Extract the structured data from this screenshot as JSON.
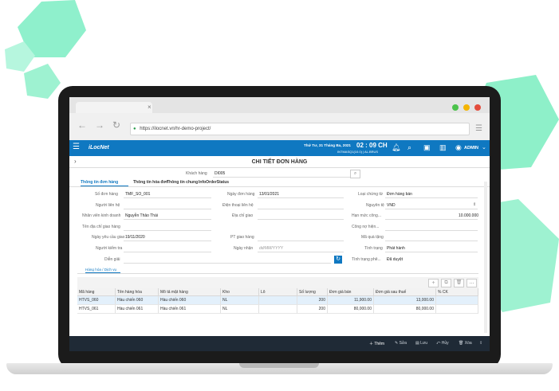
{
  "browser": {
    "url": "https://ilocnet.vn/hr-demo-project/"
  },
  "app": {
    "logo": "iLocNet",
    "datetime": "Thứ Tư, 31 Tháng Ba, 2021",
    "clock": "02 : 09 CH",
    "sub_info": "INTMASQ1(10.0) | AL.BRUS",
    "user": "ADMIN"
  },
  "page": {
    "title": "CHI TIẾT ĐƠN HÀNG",
    "customer_label": "Khách hàng",
    "customer_value": "DI005"
  },
  "tabs": [
    {
      "label": "Thông tin đơn hàng"
    },
    {
      "label": "Thông tin hóa đơn"
    },
    {
      "label": "Thông tin chung"
    },
    {
      "label": "InfoOrderStatus"
    }
  ],
  "form": {
    "col1": [
      {
        "label": "Số đơn hàng",
        "value": "TMF_SO_001"
      },
      {
        "label": "Người liên hệ",
        "value": ""
      },
      {
        "label": "Nhân viên kinh doanh",
        "value": "Nguyễn Thảo Thái"
      },
      {
        "label": "Tên địa chỉ giao hàng",
        "value": ""
      },
      {
        "label": "Ngày yêu cầu giao",
        "value": "19/11/2020"
      },
      {
        "label": "Người kiểm tra",
        "value": ""
      },
      {
        "label": "Diễn giải",
        "value": ""
      }
    ],
    "col2": [
      {
        "label": "Ngày đơn hàng",
        "value": "13/01/2021"
      },
      {
        "label": "Điện thoại liên hệ",
        "value": ""
      },
      {
        "label": "Địa chỉ giao",
        "value": ""
      },
      {
        "label": "",
        "value": ""
      },
      {
        "label": "PT giao hàng",
        "value": ""
      },
      {
        "label": "Ngày nhận",
        "value": "dd/MM/YYYY"
      }
    ],
    "col3": [
      {
        "label": "Loại chứng từ",
        "value": "Đơn hàng bán"
      },
      {
        "label": "Nguyên tệ",
        "value": "VND"
      },
      {
        "label": "Hạn mức công...",
        "value": "10.000.000"
      },
      {
        "label": "Công nợ hiện...",
        "value": ""
      },
      {
        "label": "Mã quà tặng",
        "value": ""
      },
      {
        "label": "Tình trạng",
        "value": "Phát hành"
      },
      {
        "label": "Tình trạng phê...",
        "value": "Đã duyệt"
      }
    ]
  },
  "detail_tab": "Hàng hóa / Dịch vụ",
  "grid": {
    "headers": [
      "Mã hàng",
      "Tên hàng hóa",
      "Mô tả mặt hàng",
      "Kho",
      "Lô",
      "Số lượng",
      "Đơn giá bán",
      "Đơn giá sau thuế",
      "% CK"
    ],
    "rows": [
      [
        "HTVS_060",
        "Hàu chiến 060",
        "Hàu chiến 060",
        "NL",
        "",
        "200",
        "11,900.00",
        "13,000.00",
        ""
      ],
      [
        "HTVS_061",
        "Hàu chiến 061",
        "Hàu chiến 061",
        "NL",
        "",
        "200",
        "80,000.00",
        "80,000.00",
        ""
      ]
    ]
  },
  "footer": {
    "add": "Thêm",
    "edit": "Sửa",
    "save": "Lưu",
    "cancel": "Hủy",
    "delete": "Xóa"
  },
  "colors": {
    "accent": "#0f78c1",
    "hex_green": "#7fe8c2",
    "footer_bg": "#1f2a36"
  }
}
